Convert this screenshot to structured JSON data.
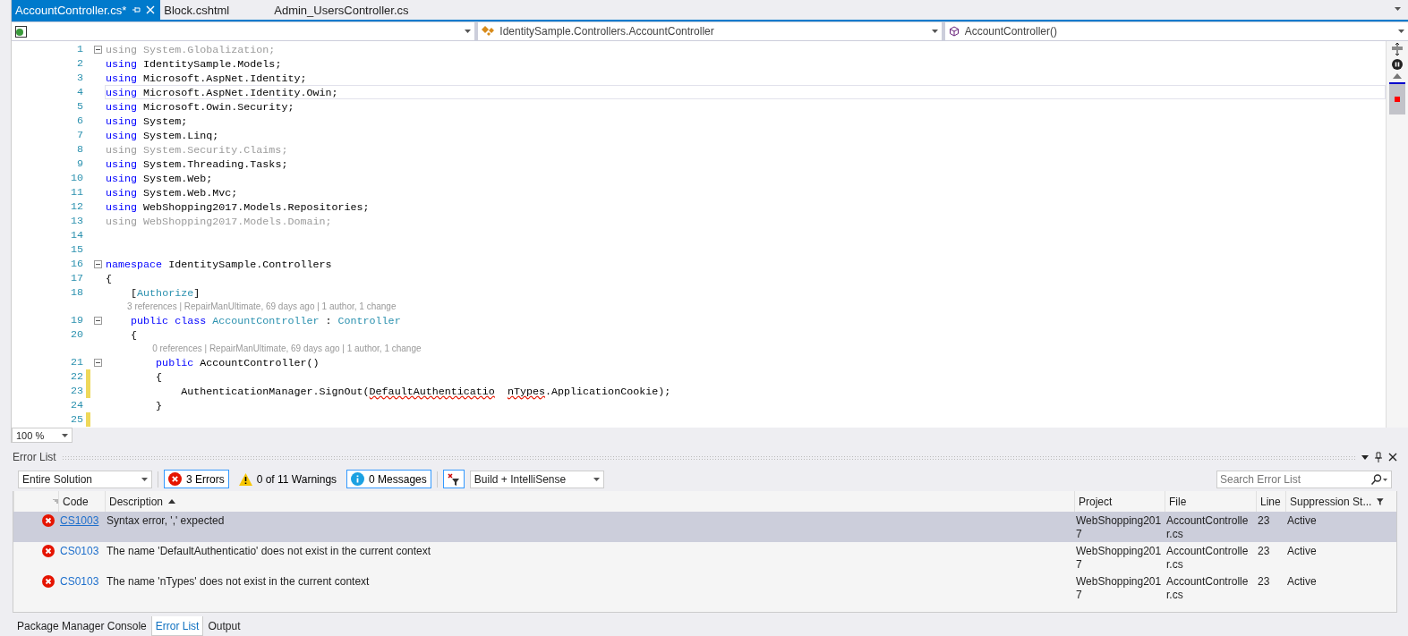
{
  "doc_tabs": [
    {
      "label": "AccountController.cs*",
      "selected": true,
      "pinned": true
    },
    {
      "label": "Block.cshtml",
      "selected": false,
      "pinned": false
    },
    {
      "label": "Admin_UsersController.cs",
      "selected": false,
      "pinned": false
    }
  ],
  "nav_bar": {
    "type": "IdentitySample.Controllers.AccountController",
    "member": "AccountController()"
  },
  "editor": {
    "lines": [
      {
        "kind": "code",
        "number": "1",
        "fold": true,
        "modified": false,
        "current": false,
        "segments": [
          {
            "kind": "dim",
            "s": "using System.Globalization;"
          }
        ]
      },
      {
        "kind": "code",
        "number": "2",
        "fold": false,
        "modified": false,
        "current": false,
        "segments": [
          {
            "kind": "kw",
            "s": "using"
          },
          {
            "kind": "plain",
            "s": " IdentitySample.Models;"
          }
        ]
      },
      {
        "kind": "code",
        "number": "3",
        "fold": false,
        "modified": false,
        "current": false,
        "segments": [
          {
            "kind": "kw",
            "s": "using"
          },
          {
            "kind": "plain",
            "s": " Microsoft.AspNet.Identity;"
          }
        ]
      },
      {
        "kind": "code",
        "number": "4",
        "fold": false,
        "modified": false,
        "current": true,
        "segments": [
          {
            "kind": "kw",
            "s": "using"
          },
          {
            "kind": "plain",
            "s": " Microsoft.AspNet.Identity.Owin;"
          }
        ]
      },
      {
        "kind": "code",
        "number": "5",
        "fold": false,
        "modified": false,
        "current": false,
        "segments": [
          {
            "kind": "kw",
            "s": "using"
          },
          {
            "kind": "plain",
            "s": " Microsoft.Owin.Security;"
          }
        ]
      },
      {
        "kind": "code",
        "number": "6",
        "fold": false,
        "modified": false,
        "current": false,
        "segments": [
          {
            "kind": "kw",
            "s": "using"
          },
          {
            "kind": "plain",
            "s": " System;"
          }
        ]
      },
      {
        "kind": "code",
        "number": "7",
        "fold": false,
        "modified": false,
        "current": false,
        "segments": [
          {
            "kind": "kw",
            "s": "using"
          },
          {
            "kind": "plain",
            "s": " System.Linq;"
          }
        ]
      },
      {
        "kind": "code",
        "number": "8",
        "fold": false,
        "modified": false,
        "current": false,
        "segments": [
          {
            "kind": "dim",
            "s": "using System.Security.Claims;"
          }
        ]
      },
      {
        "kind": "code",
        "number": "9",
        "fold": false,
        "modified": false,
        "current": false,
        "segments": [
          {
            "kind": "kw",
            "s": "using"
          },
          {
            "kind": "plain",
            "s": " System.Threading.Tasks;"
          }
        ]
      },
      {
        "kind": "code",
        "number": "10",
        "fold": false,
        "modified": false,
        "current": false,
        "segments": [
          {
            "kind": "kw",
            "s": "using"
          },
          {
            "kind": "plain",
            "s": " System.Web;"
          }
        ]
      },
      {
        "kind": "code",
        "number": "11",
        "fold": false,
        "modified": false,
        "current": false,
        "segments": [
          {
            "kind": "kw",
            "s": "using"
          },
          {
            "kind": "plain",
            "s": " System.Web.Mvc;"
          }
        ]
      },
      {
        "kind": "code",
        "number": "12",
        "fold": false,
        "modified": false,
        "current": false,
        "segments": [
          {
            "kind": "kw",
            "s": "using"
          },
          {
            "kind": "plain",
            "s": " WebShopping2017.Models.Repositories;"
          }
        ]
      },
      {
        "kind": "code",
        "number": "13",
        "fold": false,
        "modified": false,
        "current": false,
        "segments": [
          {
            "kind": "dim",
            "s": "using WebShopping2017.Models.Domain;"
          }
        ]
      },
      {
        "kind": "code",
        "number": "14",
        "fold": false,
        "modified": false,
        "current": false
      },
      {
        "kind": "code",
        "number": "15",
        "fold": false,
        "modified": false,
        "current": false
      },
      {
        "kind": "code",
        "number": "16",
        "fold": true,
        "modified": false,
        "current": false,
        "segments": [
          {
            "kind": "kw",
            "s": "namespace"
          },
          {
            "kind": "plain",
            "s": " IdentitySample.Controllers"
          }
        ]
      },
      {
        "kind": "code",
        "number": "17",
        "fold": false,
        "modified": false,
        "current": false,
        "segments": [
          {
            "kind": "plain",
            "s": "{"
          }
        ]
      },
      {
        "kind": "code",
        "number": "18",
        "fold": false,
        "modified": false,
        "current": false,
        "segments": [
          {
            "kind": "plain",
            "s": "    ["
          },
          {
            "kind": "type",
            "s": "Authorize"
          },
          {
            "kind": "plain",
            "s": "]"
          }
        ]
      },
      {
        "kind": "lens",
        "text": "3 references | RepairManUltimate, 69 days ago | 1 author, 1 change"
      },
      {
        "kind": "code",
        "number": "19",
        "fold": true,
        "modified": false,
        "current": false,
        "segments": [
          {
            "kind": "kw",
            "s": "    public class"
          },
          {
            "kind": "type",
            "s": " AccountController"
          },
          {
            "kind": "plain",
            "s": " : "
          },
          {
            "kind": "type",
            "s": "Controller"
          }
        ]
      },
      {
        "kind": "code",
        "number": "20",
        "fold": false,
        "modified": false,
        "current": false,
        "segments": [
          {
            "kind": "plain",
            "s": "    {"
          }
        ]
      },
      {
        "kind": "lens",
        "text": "0 references | RepairManUltimate, 69 days ago | 1 author, 1 change"
      },
      {
        "kind": "code",
        "number": "21",
        "fold": true,
        "modified": false,
        "current": false,
        "segments": [
          {
            "kind": "kw",
            "s": "        public"
          },
          {
            "kind": "plain",
            "s": " AccountController()"
          }
        ]
      },
      {
        "kind": "code",
        "number": "22",
        "fold": false,
        "modified": true,
        "current": false,
        "segments": [
          {
            "kind": "plain",
            "s": "        {"
          }
        ]
      },
      {
        "kind": "code",
        "number": "23",
        "fold": false,
        "modified": true,
        "current": false,
        "segments": [
          {
            "kind": "plain",
            "s": "            AuthenticationManager.SignOut("
          },
          {
            "kind": "error",
            "s": "DefaultAuthenticatio"
          },
          {
            "kind": "error",
            "s": "  nTypes"
          },
          {
            "kind": "plain",
            "s": ".ApplicationCookie);"
          }
        ]
      },
      {
        "kind": "code",
        "number": "24",
        "fold": false,
        "modified": false,
        "current": false,
        "segments": [
          {
            "kind": "plain",
            "s": "        }"
          }
        ]
      },
      {
        "kind": "code",
        "number": "25",
        "fold": false,
        "modified": true,
        "current": false
      }
    ],
    "zoom": "100 %"
  },
  "error_list": {
    "title": "Error List",
    "scope": "Entire Solution",
    "filters": [
      {
        "kind": "error",
        "label": "3 Errors",
        "selected": true
      },
      {
        "kind": "warning",
        "label": "0 of 11 Warnings",
        "selected": false
      },
      {
        "kind": "info",
        "label": "0 Messages",
        "selected": true
      }
    ],
    "source": "Build + IntelliSense",
    "search": {
      "placeholder": "Search Error List"
    },
    "columns": [
      "Code",
      "Description",
      "Project",
      "File",
      "Line",
      "Suppression St..."
    ],
    "rows": [
      {
        "selected": true,
        "code": "CS1003",
        "description": "Syntax error, ',' expected",
        "project": "WebShopping2017",
        "file": "AccountController.cs",
        "line": "23",
        "suppression": "Active"
      },
      {
        "selected": false,
        "code": "CS0103",
        "description": "The name 'DefaultAuthenticatio' does not exist in the current context",
        "project": "WebShopping2017",
        "file": "AccountController.cs",
        "line": "23",
        "suppression": "Active"
      },
      {
        "selected": false,
        "code": "CS0103",
        "description": "The name 'nTypes' does not exist in the current context",
        "project": "WebShopping2017",
        "file": "AccountController.cs",
        "line": "23",
        "suppression": "Active"
      }
    ]
  },
  "bottom_tabs": [
    {
      "label": "Package Manager Console",
      "selected": false
    },
    {
      "label": "Error List",
      "selected": true
    },
    {
      "label": "Output",
      "selected": false
    }
  ]
}
